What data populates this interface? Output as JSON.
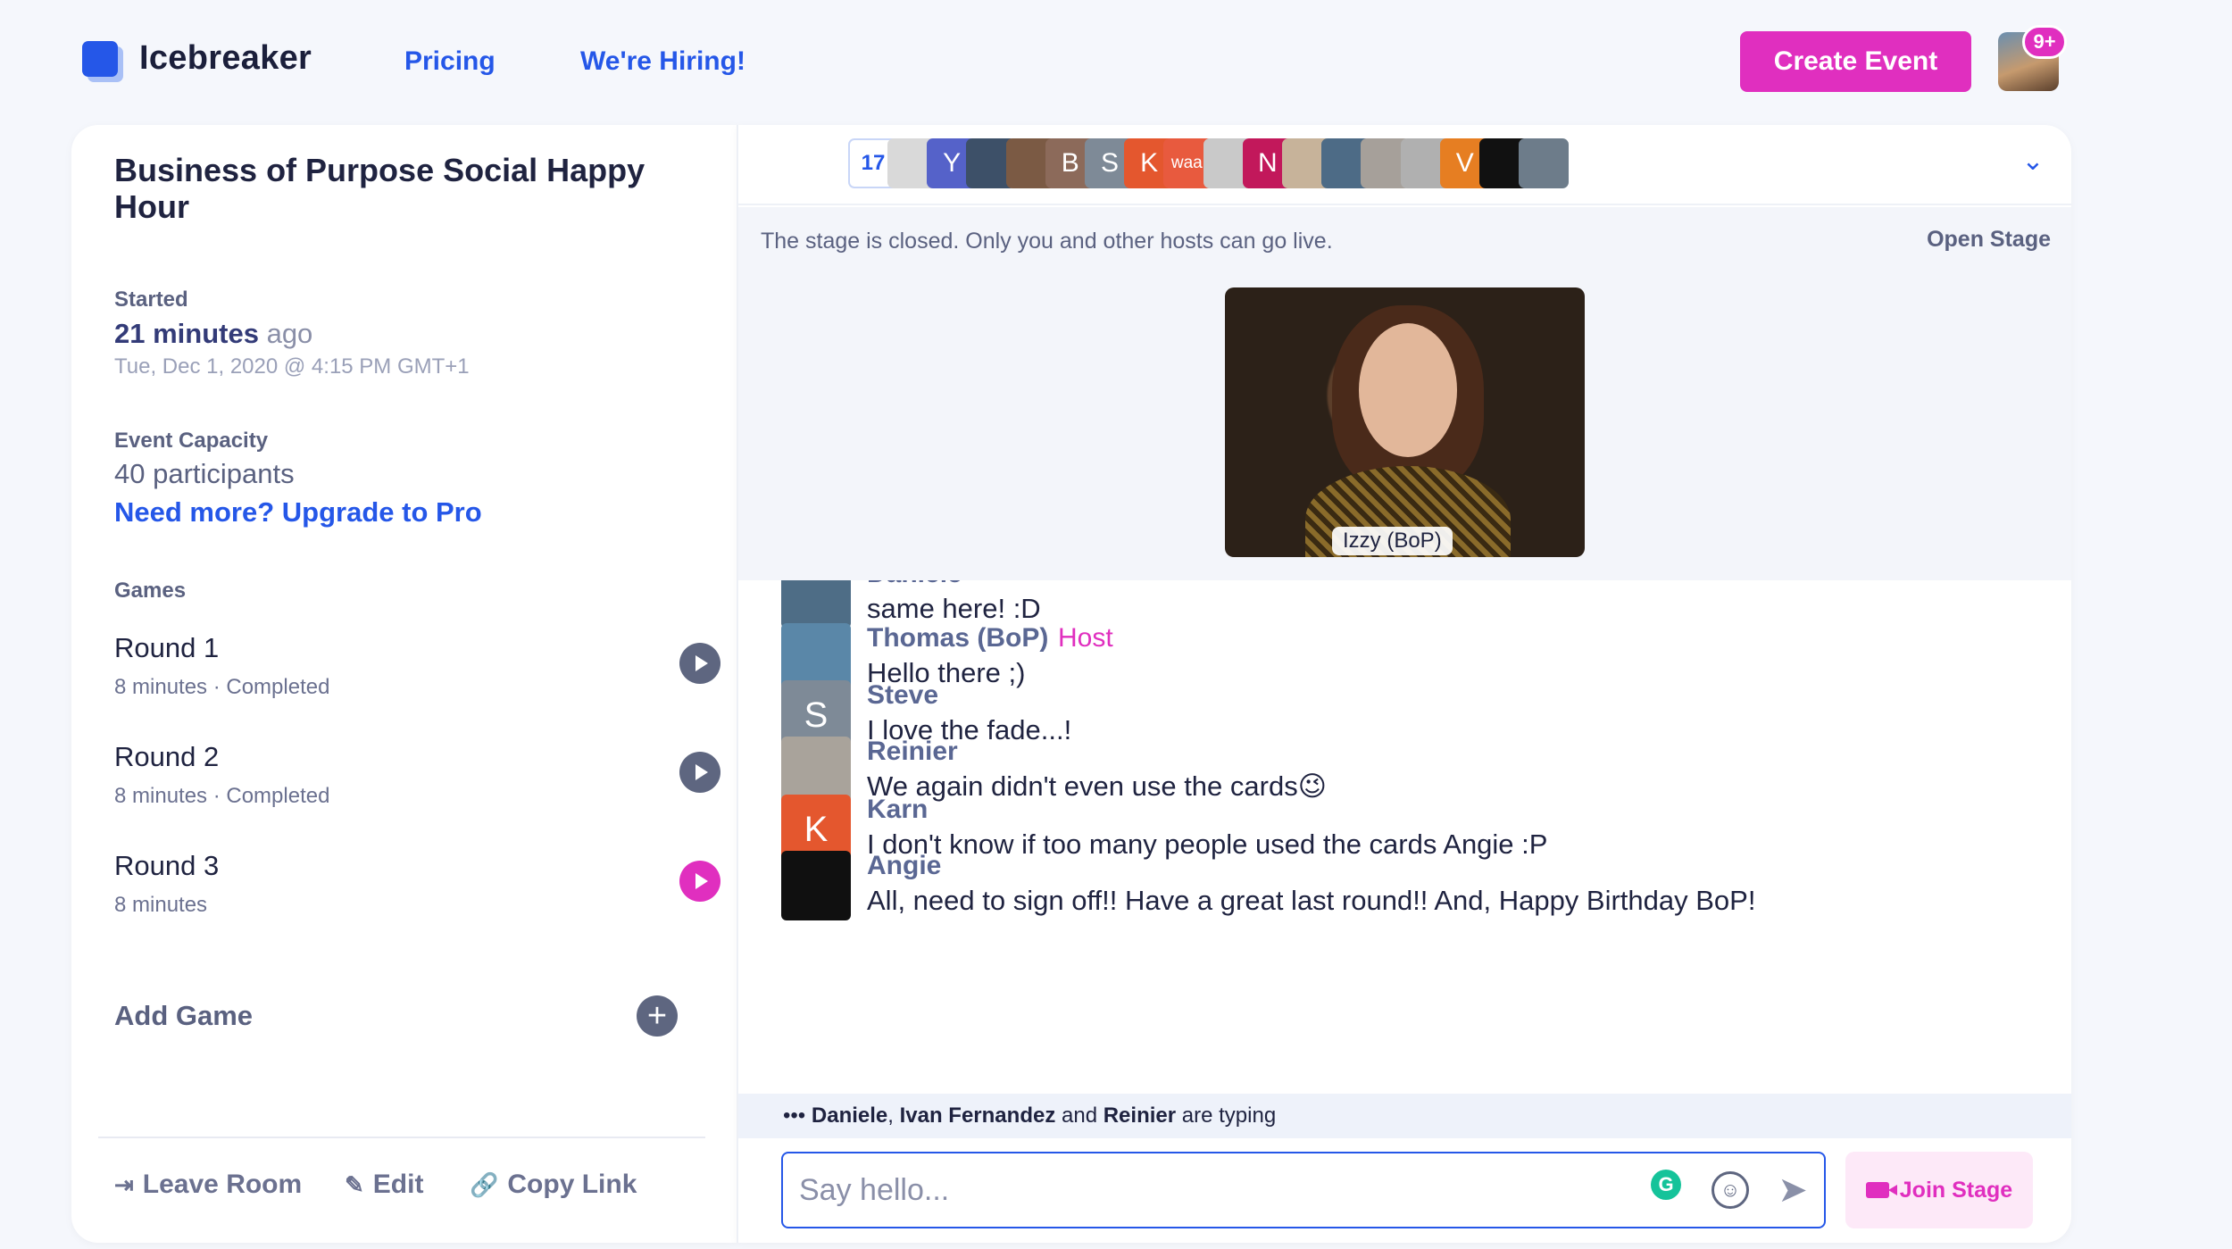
{
  "nav": {
    "brand": "Icebreaker",
    "links": [
      "Pricing",
      "We're Hiring!"
    ],
    "create_button": "Create Event",
    "notification_count": "9+"
  },
  "sidebar": {
    "event_title": "Business of Purpose Social Happy Hour",
    "started_label": "Started",
    "started_duration": "21 minutes",
    "started_suffix": "ago",
    "started_date": "Tue, Dec 1, 2020 @ 4:15 PM GMT+1",
    "capacity_label": "Event Capacity",
    "capacity_value": "40 participants",
    "upgrade_link": "Need more? Upgrade to Pro",
    "games_label": "Games",
    "rounds": [
      {
        "name": "Round 1",
        "meta": "8 minutes · Completed",
        "active": false
      },
      {
        "name": "Round 2",
        "meta": "8 minutes · Completed",
        "active": false
      },
      {
        "name": "Round 3",
        "meta": "8 minutes",
        "active": true
      }
    ],
    "add_game": "Add Game",
    "footer": {
      "leave": "Leave Room",
      "edit": "Edit",
      "copy": "Copy Link"
    }
  },
  "participants": {
    "count": "17",
    "avatars": [
      {
        "kind": "photo",
        "color": "#d9d9d9",
        "letter": ""
      },
      {
        "kind": "letter",
        "color": "#5562c9",
        "letter": "Y"
      },
      {
        "kind": "photo",
        "color": "#3d5068",
        "letter": ""
      },
      {
        "kind": "photo",
        "color": "#7b5a44",
        "letter": ""
      },
      {
        "kind": "letter",
        "color": "#8c6a5a",
        "letter": "B"
      },
      {
        "kind": "letter",
        "color": "#7e8a97",
        "letter": "S"
      },
      {
        "kind": "letter",
        "color": "#e4572e",
        "letter": "K"
      },
      {
        "kind": "text",
        "color": "#e85a3e",
        "letter": "waai"
      },
      {
        "kind": "photo",
        "color": "#c9c9c9",
        "letter": ""
      },
      {
        "kind": "letter",
        "color": "#c2185b",
        "letter": "N"
      },
      {
        "kind": "photo",
        "color": "#c7b39a",
        "letter": ""
      },
      {
        "kind": "photo",
        "color": "#4d6b86",
        "letter": ""
      },
      {
        "kind": "photo",
        "color": "#a6a09a",
        "letter": ""
      },
      {
        "kind": "photo",
        "color": "#b0b0b0",
        "letter": ""
      },
      {
        "kind": "letter",
        "color": "#e67e22",
        "letter": "V"
      },
      {
        "kind": "photo",
        "color": "#111111",
        "letter": ""
      },
      {
        "kind": "photo",
        "color": "#6d7c8a",
        "letter": ""
      }
    ]
  },
  "stage": {
    "message": "The stage is closed. Only you and other hosts can go live.",
    "open_button": "Open Stage",
    "speaker_name": "Izzy (BoP)"
  },
  "chat": {
    "messages": [
      {
        "name": "Daniele",
        "host": "",
        "text": "same here! :D",
        "avatar_color": "#4e6d86",
        "avatar_letter": ""
      },
      {
        "name": "Thomas (BoP)",
        "host": "Host",
        "text": "Hello there ;)",
        "avatar_color": "#5a87a8",
        "avatar_letter": ""
      },
      {
        "name": "Steve",
        "host": "",
        "text": "I love the fade...!",
        "avatar_color": "#7e8a97",
        "avatar_letter": "S"
      },
      {
        "name": "Reinier",
        "host": "",
        "text": "We again didn't even use the cards😉",
        "avatar_color": "#a9a39b",
        "avatar_letter": ""
      },
      {
        "name": "Karn",
        "host": "",
        "text": "I don't know if too many people used the cards Angie :P",
        "avatar_color": "#e4572e",
        "avatar_letter": "K"
      },
      {
        "name": "Angie",
        "host": "",
        "text": "All, need to sign off!! Have a great last round!! And, Happy Birthday BoP!",
        "avatar_color": "#101010",
        "avatar_letter": ""
      }
    ],
    "typing": {
      "prefix": "•••",
      "user1": "Daniele",
      "user2": "Ivan Fernandez",
      "and": "and",
      "user3": "Reinier",
      "suffix": "are typing"
    },
    "input_placeholder": "Say hello...",
    "join_stage": "Join Stage"
  },
  "colors": {
    "accent": "#2557e8",
    "brand_pink": "#e02fbf"
  }
}
